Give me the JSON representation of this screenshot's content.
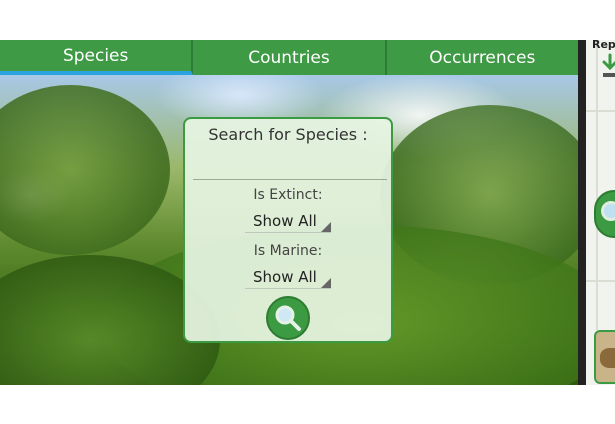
{
  "tabs": [
    {
      "label": "Species",
      "active": true
    },
    {
      "label": "Countries",
      "active": false
    },
    {
      "label": "Occurrences",
      "active": false
    }
  ],
  "search_panel": {
    "title": "Search for Species :",
    "species_input": {
      "value": "",
      "placeholder": ""
    },
    "extinct": {
      "label": "Is Extinct:",
      "value": "Show All"
    },
    "marine": {
      "label": "Is Marine:",
      "value": "Show All"
    },
    "search_button_icon": "magnifier-icon"
  },
  "right_panel": {
    "title_partial": "Repu",
    "logo_icon": "gbif-logo-icon",
    "search_icon": "magnifier-icon"
  },
  "colors": {
    "tab_green": "#3f9a45",
    "tab_active_underline": "#2aa3e0",
    "panel_border": "#3c9a42",
    "panel_background": "#e6f4e2"
  }
}
